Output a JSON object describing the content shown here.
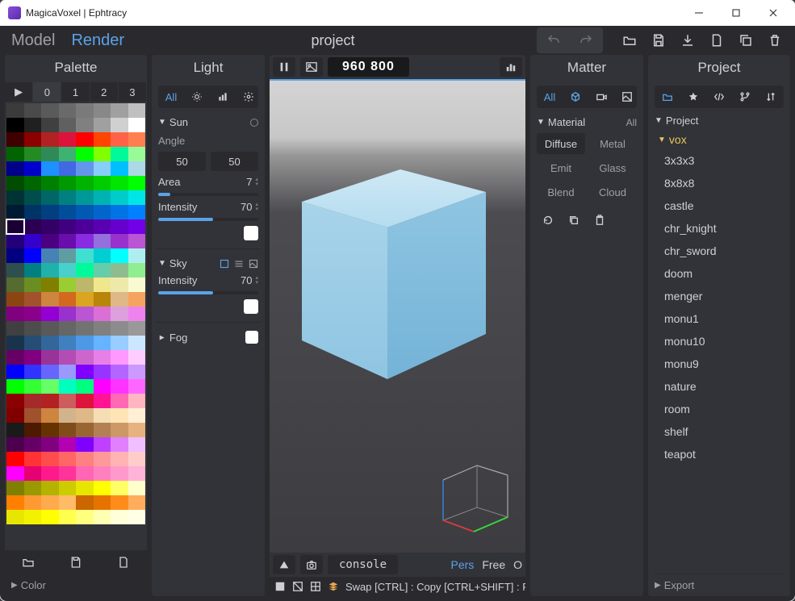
{
  "app": {
    "title": "MagicaVoxel | Ephtracy"
  },
  "topbar": {
    "tabs": {
      "model": "Model",
      "render": "Render",
      "active": "render"
    },
    "project_label": "project"
  },
  "viewport": {
    "resolution": "960  800",
    "console": "console",
    "camera": {
      "pers": "Pers",
      "free": "Free",
      "ortho": "O"
    },
    "status_hint": "Swap [CTRL] : Copy [CTRL+SHIFT] : Pick [AL"
  },
  "palette": {
    "title": "Palette",
    "tabs": [
      "▶",
      "0",
      "1",
      "2",
      "3"
    ],
    "color_section": "Color"
  },
  "light": {
    "title": "Light",
    "mode_all": "All",
    "sun": {
      "label": "Sun",
      "angle_label": "Angle",
      "angle_a": "50",
      "angle_b": "50",
      "area_label": "Area",
      "area_value": "7",
      "intensity_label": "Intensity",
      "intensity_value": "70"
    },
    "sky": {
      "label": "Sky",
      "intensity_label": "Intensity",
      "intensity_value": "70"
    },
    "fog": {
      "label": "Fog"
    }
  },
  "matter": {
    "title": "Matter",
    "mode_all": "All",
    "material_label": "Material",
    "material_all": "All",
    "cells": [
      "Diffuse",
      "Metal",
      "Emit",
      "Glass",
      "Blend",
      "Cloud"
    ]
  },
  "project": {
    "title": "Project",
    "label": "Project",
    "folder": "vox",
    "items": [
      "3x3x3",
      "8x8x8",
      "castle",
      "chr_knight",
      "chr_sword",
      "doom",
      "menger",
      "monu1",
      "monu10",
      "monu9",
      "nature",
      "room",
      "shelf",
      "teapot"
    ],
    "export": "Export"
  },
  "palette_colors": [
    "#3b3b3b",
    "#4a4a4a",
    "#5a5a5a",
    "#6a6a6a",
    "#7a7a7a",
    "#888",
    "#a0a0a0",
    "#c0c0c0",
    "#000",
    "#202020",
    "#404040",
    "#606060",
    "#808080",
    "#a0a0a0",
    "#d0d0d0",
    "#fff",
    "#400000",
    "#8b0000",
    "#b22222",
    "#dc143c",
    "#ff0000",
    "#ff4500",
    "#ff6347",
    "#ff7f50",
    "#006400",
    "#228b22",
    "#2e8b57",
    "#3cb371",
    "#00ff00",
    "#7fff00",
    "#00fa9a",
    "#98fb98",
    "#00008b",
    "#0000cd",
    "#1e90ff",
    "#4169e1",
    "#6495ed",
    "#87cefa",
    "#00bfff",
    "#add8e6",
    "#004d00",
    "#006600",
    "#008000",
    "#009900",
    "#00b300",
    "#00cc00",
    "#00e600",
    "#00ff00",
    "#003333",
    "#004d4d",
    "#006666",
    "#008080",
    "#009999",
    "#00b3b3",
    "#00cccc",
    "#00e6e6",
    "#001a33",
    "#003366",
    "#004080",
    "#004d99",
    "#0059b3",
    "#0066cc",
    "#0073e6",
    "#0080ff",
    "#1a0033",
    "#2b0052",
    "#330066",
    "#40007f",
    "#4d0099",
    "#5900b3",
    "#6600cc",
    "#7300e6",
    "#23007a",
    "#3300cc",
    "#4b0082",
    "#6a0dad",
    "#8a2be2",
    "#9370db",
    "#9932cc",
    "#ba55d3",
    "#000080",
    "#0000ff",
    "#4682b4",
    "#5f9ea0",
    "#40e0d0",
    "#00ced1",
    "#00ffff",
    "#afeeee",
    "#2f4f4f",
    "#008080",
    "#20b2aa",
    "#48d1cc",
    "#00fa9a",
    "#66cdaa",
    "#8fbc8f",
    "#90ee90",
    "#556b2f",
    "#6b8e23",
    "#808000",
    "#9acd32",
    "#bdb76b",
    "#f0e68c",
    "#eee8aa",
    "#fafad2",
    "#8b4513",
    "#a0522d",
    "#cd853f",
    "#d2691e",
    "#daa520",
    "#b8860b",
    "#deb887",
    "#f4a460",
    "#800080",
    "#8b008b",
    "#9400d3",
    "#9932cc",
    "#ba55d3",
    "#da70d6",
    "#dda0dd",
    "#ee82ee",
    "#404040",
    "#4d4d4d",
    "#595959",
    "#666666",
    "#737373",
    "#808080",
    "#8c8c8c",
    "#999999",
    "#1a334d",
    "#264d73",
    "#336699",
    "#4080bf",
    "#4d99e6",
    "#66b3ff",
    "#99ccff",
    "#cce6ff",
    "#660066",
    "#800080",
    "#993399",
    "#b34db3",
    "#cc66cc",
    "#e680e6",
    "#ff99ff",
    "#ffccff",
    "#0000ff",
    "#3333ff",
    "#6666ff",
    "#9999ff",
    "#8000ff",
    "#9933ff",
    "#b266ff",
    "#cc99ff",
    "#00ff00",
    "#33ff33",
    "#66ff66",
    "#00ffbf",
    "#00ff80",
    "#ff00ff",
    "#ff33ff",
    "#ff66ff",
    "#8b0000",
    "#a52a2a",
    "#b22222",
    "#cd5c5c",
    "#dc143c",
    "#ff1493",
    "#ff69b4",
    "#ffb6c1",
    "#800000",
    "#a0522d",
    "#cd853f",
    "#d2b48c",
    "#deb887",
    "#f5deb3",
    "#ffe4b5",
    "#ffefd5",
    "#1a1a1a",
    "#4d1a00",
    "#663300",
    "#804d1a",
    "#996633",
    "#b38053",
    "#cc9966",
    "#e6b380",
    "#4d004d",
    "#660066",
    "#800080",
    "#b300b3",
    "#7f00ff",
    "#bf40ff",
    "#e080ff",
    "#f0bfff",
    "#ff0000",
    "#ff3333",
    "#ff4d4d",
    "#ff6666",
    "#ff8080",
    "#ff9999",
    "#ffb3b3",
    "#ffcccc",
    "#ff00ff",
    "#e60073",
    "#ff1a8c",
    "#ff3399",
    "#ff66b3",
    "#ff80bf",
    "#ff99cc",
    "#ffb3d9",
    "#808000",
    "#999900",
    "#b3b300",
    "#cccc00",
    "#e6e600",
    "#ffff00",
    "#ffff66",
    "#ffffcc",
    "#ff8000",
    "#ff9933",
    "#ffaa4d",
    "#ffbb66",
    "#cc6600",
    "#e67300",
    "#ff8c1a",
    "#ffad5c",
    "#e6e600",
    "#f2f200",
    "#ffff00",
    "#ffff4d",
    "#ffff80",
    "#ffffb3",
    "#ffffd9",
    "#ffffe6"
  ],
  "palette_selected_index": 64
}
